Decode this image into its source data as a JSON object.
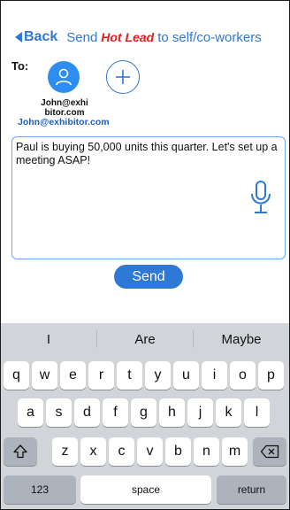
{
  "header": {
    "back_label": "Back",
    "title_prefix": "Send",
    "title_hot": "Hot Lead",
    "title_suffix": "to self/co-workers"
  },
  "recipients": {
    "to_label": "To:",
    "items": [
      {
        "name_line1": "John@exhi",
        "name_line2": "bitor.com",
        "email": "John@exhibitor.com"
      }
    ]
  },
  "message": {
    "text": "Paul is buying 50,000 units this quarter. Let's set up a meeting ASAP!"
  },
  "send_label": "Send",
  "keyboard": {
    "suggestions": [
      "I",
      "Are",
      "Maybe"
    ],
    "row1": [
      "q",
      "w",
      "e",
      "r",
      "t",
      "y",
      "u",
      "i",
      "o",
      "p"
    ],
    "row2": [
      "a",
      "s",
      "d",
      "f",
      "g",
      "h",
      "j",
      "k",
      "l"
    ],
    "row3": [
      "z",
      "x",
      "c",
      "v",
      "b",
      "n",
      "m"
    ],
    "numbers_label": "123",
    "space_label": "space",
    "return_label": "return"
  },
  "colors": {
    "accent": "#2e78d6",
    "hot": "#e01f1f",
    "keyboard_bg": "#d1d4d9"
  }
}
